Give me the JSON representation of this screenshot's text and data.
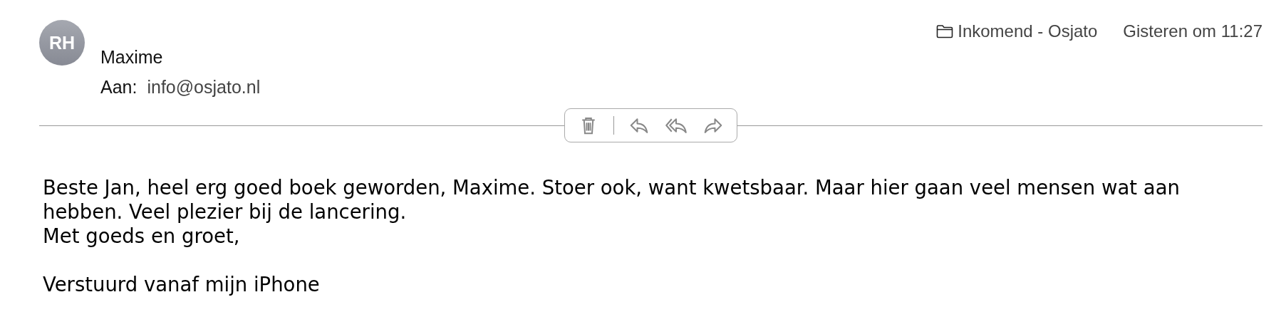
{
  "header": {
    "avatar_initials": "RH",
    "subject": "Maxime",
    "to_label": "Aan:",
    "to_address": "info@osjato.nl",
    "mailbox": "Inkomend - Osjato",
    "date": "Gisteren om 11:27"
  },
  "toolbar": {
    "buttons": [
      {
        "kind": "trash"
      },
      {
        "kind": "reply"
      },
      {
        "kind": "reply-all"
      },
      {
        "kind": "forward"
      }
    ]
  },
  "body": {
    "sections": [
      {
        "lines": [
          "Beste Jan, heel erg goed boek geworden, Maxime. Stoer ook, want kwetsbaar. Maar hier gaan veel mensen wat aan hebben. Veel plezier bij de lancering.",
          "Met goeds en groet,"
        ]
      },
      {
        "lines": [
          "Verstuurd vanaf mijn iPhone"
        ]
      }
    ]
  }
}
